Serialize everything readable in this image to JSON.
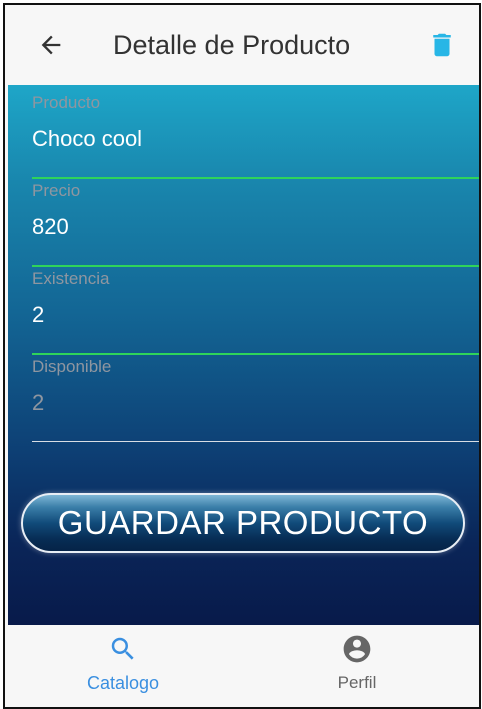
{
  "app_bar": {
    "title": "Detalle de Producto",
    "back_icon": "arrow-back-icon",
    "delete_icon": "trash-icon"
  },
  "form": {
    "fields": [
      {
        "label": "Producto",
        "value": "Choco cool",
        "disabled": false
      },
      {
        "label": "Precio",
        "value": "820",
        "disabled": false
      },
      {
        "label": "Existencia",
        "value": "2",
        "disabled": false
      },
      {
        "label": "Disponible",
        "value": "2",
        "disabled": true
      }
    ],
    "save_button_label": "GUARDAR PRODUCTO"
  },
  "bottom_nav": {
    "items": [
      {
        "label": "Catalogo",
        "icon": "search-icon",
        "active": true
      },
      {
        "label": "Perfil",
        "icon": "account-circle-icon",
        "active": false
      }
    ]
  },
  "colors": {
    "accent": "#27b6e6",
    "active_nav": "#3a8fe0",
    "inactive_nav": "#666666",
    "field_underline": "#2fd45a",
    "label_gray": "#8f96a0"
  }
}
